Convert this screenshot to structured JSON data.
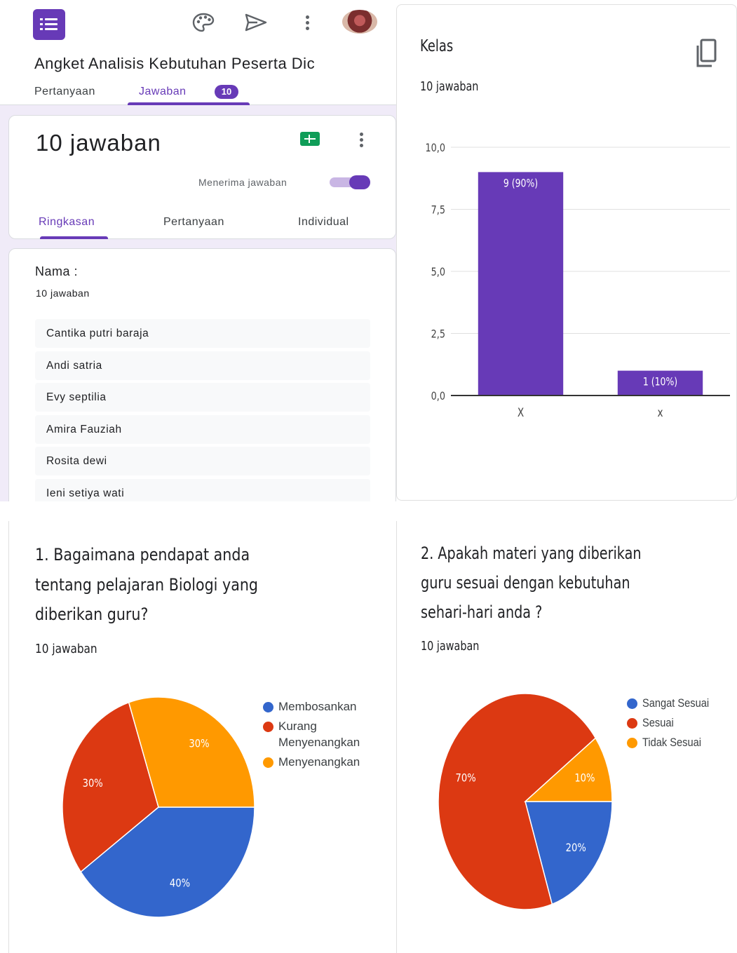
{
  "app": {
    "form_title": "Angket Analisis Kebutuhan Peserta Dic",
    "tabs": {
      "questions": "Pertanyaan",
      "responses": "Jawaban",
      "response_badge": "10"
    },
    "toolbar_icons": [
      "forms-logo-icon",
      "palette-icon",
      "send-icon",
      "more-vert-icon",
      "avatar"
    ]
  },
  "summary": {
    "count_label": "10 jawaban",
    "accepting_label": "Menerima jawaban",
    "accepting": true,
    "subtabs": {
      "summary": "Ringkasan",
      "question": "Pertanyaan",
      "individual": "Individual"
    }
  },
  "nama_question": {
    "title": "Nama :",
    "count": "10 jawaban",
    "answers": [
      "Cantika putri baraja",
      "Andi satria",
      "Evy septilia",
      "Amira Fauziah",
      "Rosita dewi",
      "Ieni setiya wati"
    ]
  },
  "kelas_question": {
    "title": "Kelas",
    "count": "10 jawaban"
  },
  "q1": {
    "title_lines": [
      "1. Bagaimana pendapat anda",
      "tentang pelajaran Biologi yang",
      "diberikan guru?"
    ],
    "count": "10 jawaban"
  },
  "q2": {
    "title_lines": [
      "2. Apakah materi yang diberikan",
      "guru sesuai dengan kebutuhan",
      "sehari-hari anda ?"
    ],
    "count": "10 jawaban"
  },
  "colors": {
    "accent": "#673ab7",
    "bar": "#673ab7",
    "blue": "#3366cc",
    "red": "#dc3912",
    "orange": "#ff9900"
  },
  "chart_data": [
    {
      "type": "bar",
      "categories": [
        "X",
        "x"
      ],
      "values": [
        9,
        1
      ],
      "data_labels": [
        "9 (90%)",
        "1 (10%)"
      ],
      "yticks": [
        "0,0",
        "2,5",
        "5,0",
        "7,5",
        "10,0"
      ],
      "ylim": [
        0,
        10
      ],
      "grid": true
    },
    {
      "type": "pie",
      "labels": [
        "Membosankan",
        "Kurang Menyenangkan",
        "Menyenangkan"
      ],
      "legend_lines": [
        [
          "Membosankan"
        ],
        [
          "Kurang",
          "Menyenangkan"
        ],
        [
          "Menyenangkan"
        ]
      ],
      "slices": [
        {
          "label": "Membosankan",
          "value": 40,
          "text": "40%",
          "color": "#3366cc"
        },
        {
          "label": "Kurang Menyenangkan",
          "value": 30,
          "text": "30%",
          "color": "#dc3912"
        },
        {
          "label": "Menyenangkan",
          "value": 30,
          "text": "30%",
          "color": "#ff9900"
        }
      ],
      "legend_position": "right"
    },
    {
      "type": "pie",
      "labels": [
        "Sangat Sesuai",
        "Sesuai",
        "Tidak Sesuai"
      ],
      "legend_lines": [
        [
          "Sangat Sesuai"
        ],
        [
          "Sesuai"
        ],
        [
          "Tidak Sesuai"
        ]
      ],
      "slices": [
        {
          "label": "Sangat Sesuai",
          "value": 20,
          "text": "20%",
          "color": "#3366cc"
        },
        {
          "label": "Sesuai",
          "value": 70,
          "text": "70%",
          "color": "#dc3912"
        },
        {
          "label": "Tidak Sesuai",
          "value": 10,
          "text": "10%",
          "color": "#ff9900"
        }
      ],
      "legend_position": "right"
    }
  ]
}
